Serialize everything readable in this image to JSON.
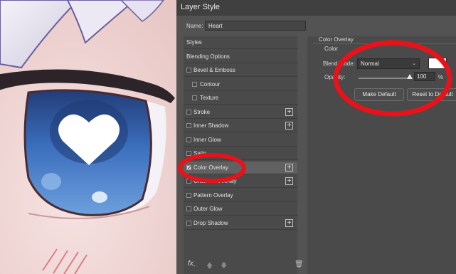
{
  "window": {
    "title": "Layer Style"
  },
  "name_field": {
    "label": "Name:",
    "value": "Heart"
  },
  "styles_list": [
    {
      "label": "Styles",
      "has_checkbox": false,
      "has_plus": false,
      "checked": false,
      "indent": false
    },
    {
      "label": "Blending Options",
      "has_checkbox": false,
      "has_plus": false,
      "checked": false,
      "indent": false
    },
    {
      "label": "Bevel & Emboss",
      "has_checkbox": true,
      "has_plus": false,
      "checked": false,
      "indent": false
    },
    {
      "label": "Contour",
      "has_checkbox": true,
      "has_plus": false,
      "checked": false,
      "indent": true
    },
    {
      "label": "Texture",
      "has_checkbox": true,
      "has_plus": false,
      "checked": false,
      "indent": true
    },
    {
      "label": "Stroke",
      "has_checkbox": true,
      "has_plus": true,
      "checked": false,
      "indent": false
    },
    {
      "label": "Inner Shadow",
      "has_checkbox": true,
      "has_plus": true,
      "checked": false,
      "indent": false
    },
    {
      "label": "Inner Glow",
      "has_checkbox": true,
      "has_plus": false,
      "checked": false,
      "indent": false
    },
    {
      "label": "Satin",
      "has_checkbox": true,
      "has_plus": false,
      "checked": false,
      "indent": false
    },
    {
      "label": "Color Overlay",
      "has_checkbox": true,
      "has_plus": true,
      "checked": true,
      "indent": false,
      "selected": true
    },
    {
      "label": "Gradient Overlay",
      "has_checkbox": true,
      "has_plus": true,
      "checked": false,
      "indent": false
    },
    {
      "label": "Pattern Overlay",
      "has_checkbox": true,
      "has_plus": false,
      "checked": false,
      "indent": false
    },
    {
      "label": "Outer Glow",
      "has_checkbox": true,
      "has_plus": false,
      "checked": false,
      "indent": false
    },
    {
      "label": "Drop Shadow",
      "has_checkbox": true,
      "has_plus": true,
      "checked": false,
      "indent": false
    }
  ],
  "footer": {
    "fx_label": "fx",
    "fx_sub": "-",
    "move_up_icon": "arrow-up-icon",
    "move_down_icon": "arrow-down-icon",
    "delete_icon": "trash-icon"
  },
  "panel": {
    "title": "Color Overlay",
    "group": "Color",
    "blend_mode_label": "Blend Mode:",
    "blend_mode_value": "Normal",
    "overlay_color": "#ffffff",
    "opacity_label": "Opacity:",
    "opacity_value": "100",
    "opacity_unit": "%",
    "make_default_label": "Make Default",
    "reset_default_label": "Reset to Default"
  },
  "colors": {
    "annotation": "#e8121a",
    "dialog_bg": "#535353",
    "eye_blue": "#3f78c4"
  }
}
